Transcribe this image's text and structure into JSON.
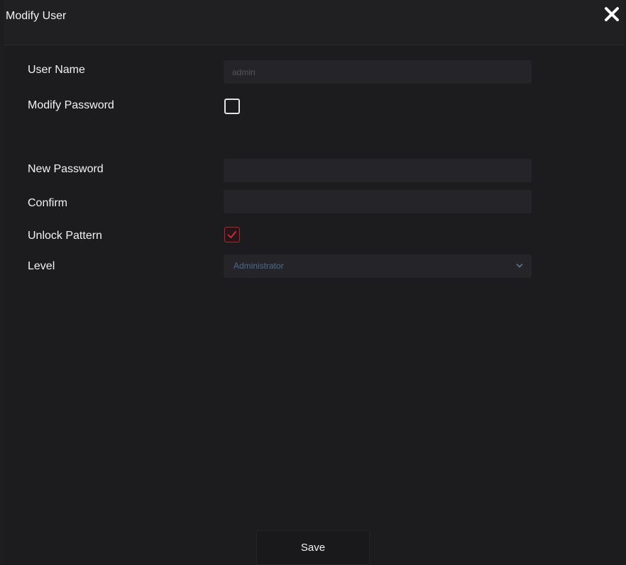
{
  "dialog": {
    "title": "Modify User",
    "close_icon": "close-icon"
  },
  "form": {
    "user_name": {
      "label": "User Name",
      "value": "admin"
    },
    "modify_password": {
      "label": "Modify Password",
      "checked": false
    },
    "new_password": {
      "label": "New Password",
      "value": ""
    },
    "confirm": {
      "label": "Confirm",
      "value": ""
    },
    "unlock_pattern": {
      "label": "Unlock Pattern",
      "checked": true
    },
    "level": {
      "label": "Level",
      "selected": "Administrator"
    }
  },
  "actions": {
    "save_label": "Save"
  },
  "colors": {
    "background": "#1c1c1f",
    "field_bg": "#252529",
    "accent_red": "#c62a37",
    "select_text": "#4c6a8a"
  }
}
